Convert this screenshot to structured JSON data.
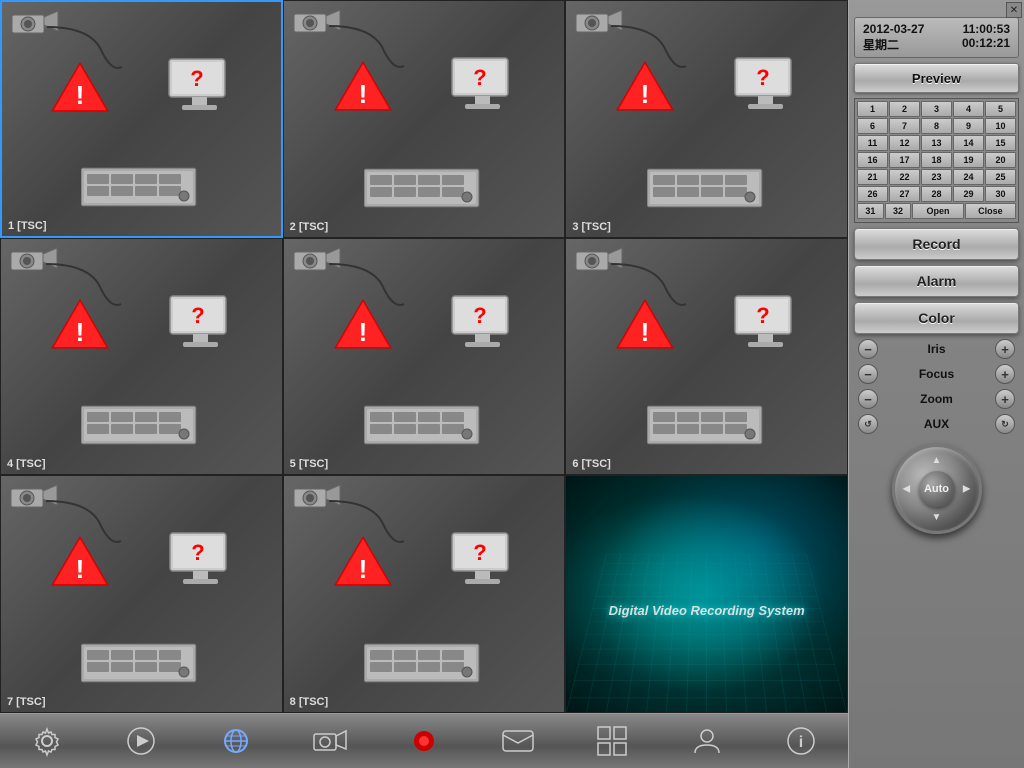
{
  "window": {
    "close_label": "✕"
  },
  "datetime": {
    "date": "2012-03-27",
    "weekday": "星期二",
    "time1": "11:00:53",
    "time2": "00:12:21"
  },
  "sidebar": {
    "preview_label": "Preview",
    "record_label": "Record",
    "alarm_label": "Alarm",
    "color_label": "Color",
    "iris_label": "Iris",
    "focus_label": "Focus",
    "zoom_label": "Zoom",
    "aux_label": "AUX",
    "auto_label": "Auto"
  },
  "channels": {
    "rows": [
      [
        "1",
        "2",
        "3",
        "4",
        "5"
      ],
      [
        "6",
        "7",
        "8",
        "9",
        "10"
      ],
      [
        "11",
        "12",
        "13",
        "14",
        "15"
      ],
      [
        "16",
        "17",
        "18",
        "19",
        "20"
      ],
      [
        "21",
        "22",
        "23",
        "24",
        "25"
      ],
      [
        "26",
        "27",
        "28",
        "29",
        "30"
      ],
      [
        "31",
        "32",
        "Open",
        "Close"
      ]
    ]
  },
  "cells": [
    {
      "id": 1,
      "label": "1 [TSC]",
      "selected": true
    },
    {
      "id": 2,
      "label": "2 [TSC]",
      "selected": false
    },
    {
      "id": 3,
      "label": "3 [TSC]",
      "selected": false
    },
    {
      "id": 4,
      "label": "4 [TSC]",
      "selected": false
    },
    {
      "id": 5,
      "label": "5 [TSC]",
      "selected": false
    },
    {
      "id": 6,
      "label": "6 [TSC]",
      "selected": false
    },
    {
      "id": 7,
      "label": "7 [TSC]",
      "selected": false
    },
    {
      "id": 8,
      "label": "8 [TSC]",
      "selected": false
    },
    {
      "id": 9,
      "label": "DVR",
      "selected": false,
      "brand": true
    }
  ],
  "dvr_brand_text": "Digital Video Recording System",
  "taskbar": {
    "buttons": [
      {
        "name": "settings-btn",
        "icon": "⚙",
        "label": "Settings"
      },
      {
        "name": "play-btn",
        "icon": "▶",
        "label": "Play"
      },
      {
        "name": "ie-btn",
        "icon": "🌐",
        "label": "IE"
      },
      {
        "name": "camera-btn",
        "icon": "📷",
        "label": "Camera"
      },
      {
        "name": "record-btn",
        "icon": "⏺",
        "label": "Record"
      },
      {
        "name": "message-btn",
        "icon": "💬",
        "label": "Message"
      },
      {
        "name": "grid-btn",
        "icon": "⊞",
        "label": "Grid"
      },
      {
        "name": "user-btn",
        "icon": "👤",
        "label": "User"
      },
      {
        "name": "info-btn",
        "icon": "ℹ",
        "label": "Info"
      }
    ]
  }
}
